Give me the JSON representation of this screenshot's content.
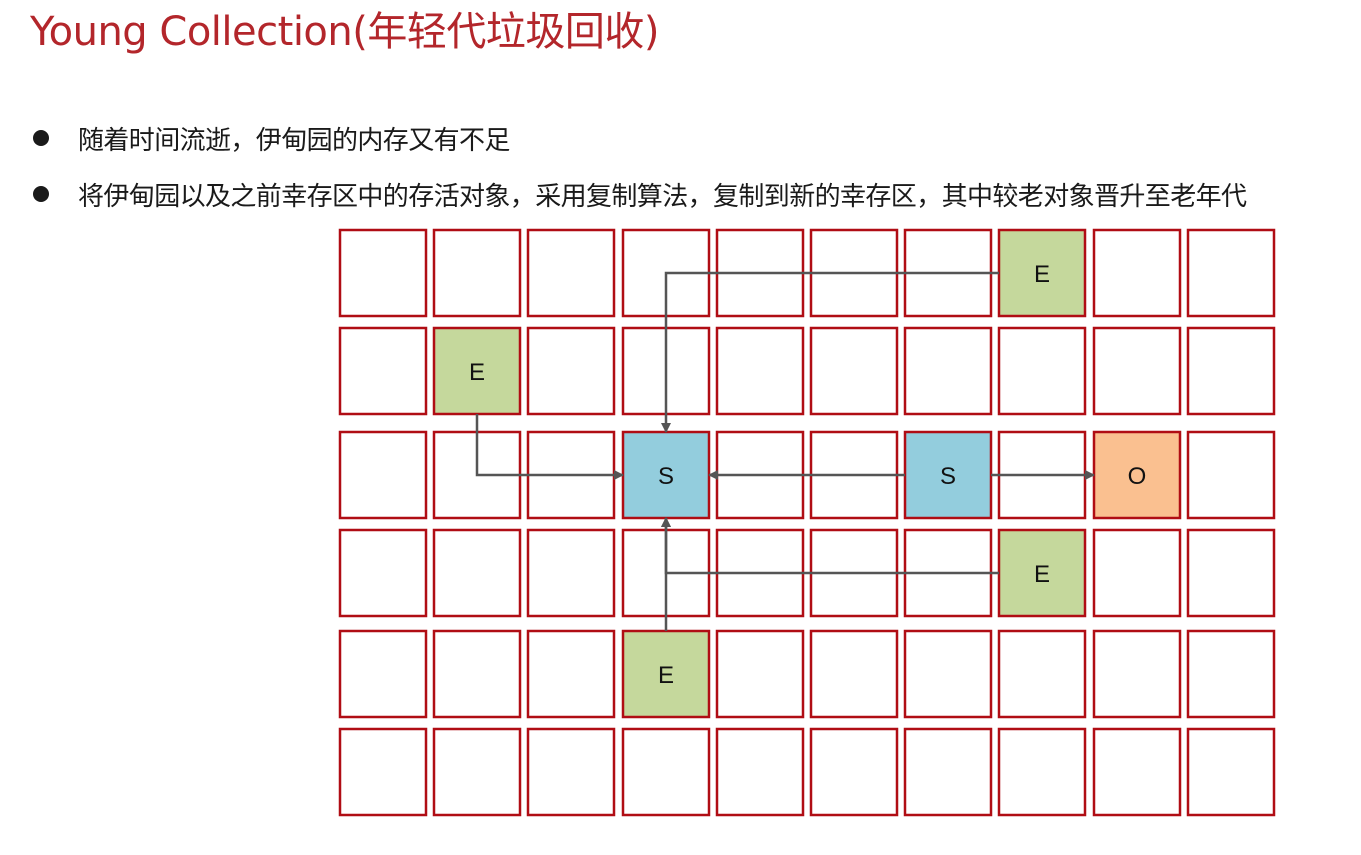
{
  "title": "Young Collection(年轻代垃圾回收)",
  "bullets": [
    "随着时间流逝，伊甸园的内存又有不足",
    "将伊甸园以及之前幸存区中的存活对象，采用复制算法，复制到新的幸存区，其中较老对象晋升至老年代"
  ],
  "grid": {
    "rows": 6,
    "cols": 10,
    "border_color": "#b00d14",
    "regions": [
      {
        "row": 0,
        "col": 7,
        "type": "eden",
        "label": "E"
      },
      {
        "row": 1,
        "col": 1,
        "type": "eden",
        "label": "E"
      },
      {
        "row": 2,
        "col": 3,
        "type": "survivor",
        "label": "S"
      },
      {
        "row": 2,
        "col": 6,
        "type": "survivor",
        "label": "S"
      },
      {
        "row": 2,
        "col": 8,
        "type": "old",
        "label": "O"
      },
      {
        "row": 3,
        "col": 7,
        "type": "eden",
        "label": "E"
      },
      {
        "row": 4,
        "col": 3,
        "type": "eden",
        "label": "E"
      }
    ]
  },
  "colors": {
    "eden": "#c5d89c",
    "survivor": "#93cddd",
    "old": "#fac090",
    "arrow": "#555555"
  },
  "arrows": [
    {
      "from": [
        0,
        7
      ],
      "to": [
        2,
        3
      ]
    },
    {
      "from": [
        1,
        1
      ],
      "to": [
        2,
        3
      ]
    },
    {
      "from": [
        2,
        6
      ],
      "to": [
        2,
        3
      ]
    },
    {
      "from": [
        2,
        6
      ],
      "to": [
        2,
        8
      ]
    },
    {
      "from": [
        3,
        7
      ],
      "to": [
        2,
        3
      ]
    },
    {
      "from": [
        4,
        3
      ],
      "to": [
        2,
        3
      ]
    }
  ]
}
